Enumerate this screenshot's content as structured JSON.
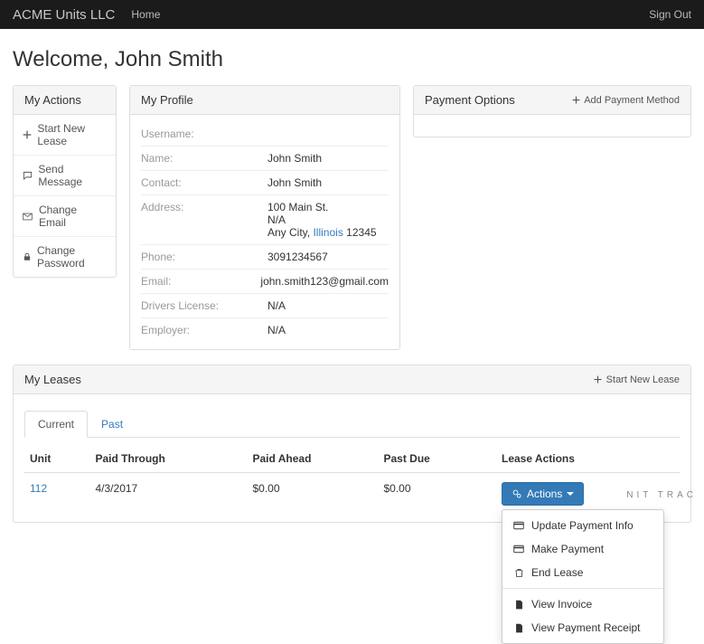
{
  "nav": {
    "brand": "ACME Units LLC",
    "home": "Home",
    "signout": "Sign Out"
  },
  "welcome": "Welcome, John Smith",
  "actions": {
    "title": "My Actions",
    "items": [
      {
        "label": "Start New Lease",
        "icon": "plus"
      },
      {
        "label": "Send Message",
        "icon": "comment"
      },
      {
        "label": "Change Email",
        "icon": "envelope"
      },
      {
        "label": "Change Password",
        "icon": "lock"
      }
    ]
  },
  "profile": {
    "title": "My Profile",
    "rows": {
      "username_label": "Username:",
      "username_value": "",
      "name_label": "Name:",
      "name_value": "John Smith",
      "contact_label": "Contact:",
      "contact_value": "John Smith",
      "address_label": "Address:",
      "address_lines": [
        "100 Main St.",
        "N/A"
      ],
      "address_city": "Any City",
      "address_state": "Illinois",
      "address_zip": "12345",
      "phone_label": "Phone:",
      "phone_value": "3091234567",
      "email_label": "Email:",
      "email_value": "john.smith123@gmail.com",
      "dl_label": "Drivers License:",
      "dl_value": "N/A",
      "employer_label": "Employer:",
      "employer_value": "N/A"
    }
  },
  "payment": {
    "title": "Payment Options",
    "add_label": "Add Payment Method"
  },
  "leases": {
    "title": "My Leases",
    "start_new": "Start New Lease",
    "tabs": {
      "current": "Current",
      "past": "Past"
    },
    "columns": {
      "unit": "Unit",
      "paid_through": "Paid Through",
      "paid_ahead": "Paid Ahead",
      "past_due": "Past Due",
      "actions": "Lease Actions"
    },
    "rows": [
      {
        "unit": "112",
        "paid_through": "4/3/2017",
        "paid_ahead": "$0.00",
        "past_due": "$0.00"
      }
    ],
    "actions_btn": "Actions",
    "dropdown": {
      "update_payment": "Update Payment Info",
      "make_payment": "Make Payment",
      "end_lease": "End Lease",
      "view_invoice": "View Invoice",
      "view_receipt": "View Payment Receipt"
    }
  },
  "footer_mark": "NIT TRAC"
}
